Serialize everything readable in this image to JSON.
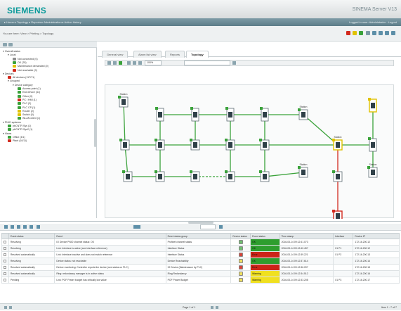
{
  "header": {
    "logo": "SIEMENS",
    "product": "SINEMA Server V13"
  },
  "nav": {
    "breadcrumbs": "▸ Home ▸ Topology ▸ Reports ▸ Administration ▸ Action history",
    "user": "Logged in user: Administrator · Logout"
  },
  "subheader": {
    "you_are_here": "You are here: View > Printing > Topology"
  },
  "tree": [
    {
      "label": "Overall status",
      "indent": 0,
      "icon": "expand",
      "color": ""
    },
    {
      "label": "Local",
      "indent": 1,
      "icon": "expand",
      "color": ""
    },
    {
      "label": "Not connected (0)",
      "indent": 2,
      "icon": "status",
      "color": "#8c8c8c"
    },
    {
      "label": "OK (78)",
      "indent": 2,
      "icon": "status",
      "color": "#3aa23a"
    },
    {
      "label": "Maintenance demanded (0)",
      "indent": 2,
      "icon": "status",
      "color": "#e0c200"
    },
    {
      "label": "Not reachable (0)",
      "indent": 2,
      "icon": "status",
      "color": "#d22a1e"
    },
    {
      "label": "Devices",
      "indent": 0,
      "icon": "expand",
      "color": ""
    },
    {
      "label": "All devices (117/71)",
      "indent": 1,
      "icon": "status",
      "color": "#d22a1e"
    },
    {
      "label": "Grouped",
      "indent": 1,
      "icon": "expand",
      "color": ""
    },
    {
      "label": "Device category",
      "indent": 2,
      "icon": "expand",
      "color": ""
    },
    {
      "label": "Access point (1)",
      "indent": 3,
      "icon": "status",
      "color": "#3aa23a"
    },
    {
      "label": "End device (41)",
      "indent": 3,
      "icon": "status",
      "color": "#3aa23a"
    },
    {
      "label": "Other (0)",
      "indent": 3,
      "icon": "status",
      "color": "#3aa23a"
    },
    {
      "label": "PC / HMI (1)",
      "indent": 3,
      "icon": "status",
      "color": "#d22a1e"
    },
    {
      "label": "PLC (2)",
      "indent": 3,
      "icon": "status",
      "color": "#3aa23a"
    },
    {
      "label": "PLC CP (1)",
      "indent": 3,
      "icon": "status",
      "color": "#3aa23a"
    },
    {
      "label": "Router (2)",
      "indent": 3,
      "icon": "status",
      "color": "#e0c200"
    },
    {
      "label": "Switch (0)",
      "indent": 3,
      "icon": "status",
      "color": "#e0c200"
    },
    {
      "label": "WLAN client (1)",
      "indent": 3,
      "icon": "status",
      "color": "#3aa23a"
    },
    {
      "label": "PNIO systems",
      "indent": 0,
      "icon": "expand",
      "color": ""
    },
    {
      "label": "pbCNTR Sys (1)",
      "indent": 1,
      "icon": "status",
      "color": "#3aa23a"
    },
    {
      "label": "pbCNTR Sys2 (1)",
      "indent": 1,
      "icon": "status",
      "color": "#3aa23a"
    },
    {
      "label": "Views",
      "indent": 0,
      "icon": "expand",
      "color": ""
    },
    {
      "label": "Office (4/1)",
      "indent": 1,
      "icon": "status",
      "color": "#3aa23a"
    },
    {
      "label": "Plant (10/11)",
      "indent": 1,
      "icon": "status",
      "color": "#d22a1e"
    }
  ],
  "tabs": [
    {
      "label": "General view"
    },
    {
      "label": "Alarm list view"
    },
    {
      "label": "Reports"
    },
    {
      "label": "Topology"
    }
  ],
  "active_tab": "Topology",
  "topo_toolbar": {
    "zoom": "100%"
  },
  "topology": {
    "nodes": [
      {
        "id": "n1",
        "label": "Station",
        "kind": "device",
        "status": "green"
      },
      {
        "id": "n2",
        "label": "",
        "kind": "device",
        "status": "green"
      },
      {
        "id": "n3",
        "label": "",
        "kind": "device",
        "status": "green"
      },
      {
        "id": "n4",
        "label": "",
        "kind": "device",
        "status": "green"
      },
      {
        "id": "n5",
        "label": "",
        "kind": "device",
        "status": "green"
      },
      {
        "id": "n6",
        "label": "",
        "kind": "device",
        "status": "green"
      },
      {
        "id": "n7",
        "label": "Station",
        "kind": "device",
        "status": "yellow"
      },
      {
        "id": "n8",
        "label": "",
        "kind": "switch",
        "status": "green"
      },
      {
        "id": "n9",
        "label": "",
        "kind": "switch",
        "status": "green"
      },
      {
        "id": "n10",
        "label": "",
        "kind": "switch",
        "status": "green"
      },
      {
        "id": "n11",
        "label": "",
        "kind": "switch",
        "status": "green"
      },
      {
        "id": "n12",
        "label": "",
        "kind": "switch",
        "status": "green"
      },
      {
        "id": "n13",
        "label": "Station",
        "kind": "device",
        "status": "green"
      },
      {
        "id": "n14",
        "label": "",
        "kind": "switch",
        "status": "yellow"
      },
      {
        "id": "n15",
        "label": "",
        "kind": "device",
        "status": "green"
      },
      {
        "id": "n16",
        "label": "",
        "kind": "device",
        "status": "green"
      },
      {
        "id": "n17",
        "label": "",
        "kind": "device",
        "status": "green"
      },
      {
        "id": "n18",
        "label": "",
        "kind": "device",
        "status": "green"
      },
      {
        "id": "n19",
        "label": "",
        "kind": "device",
        "status": "green"
      },
      {
        "id": "n20",
        "label": "Station",
        "kind": "device",
        "status": "green"
      },
      {
        "id": "n21",
        "label": "",
        "kind": "device",
        "status": "green"
      },
      {
        "id": "n22",
        "label": "",
        "kind": "device",
        "status": "red"
      },
      {
        "id": "n23",
        "label": "Station",
        "kind": "device",
        "status": "green"
      }
    ]
  },
  "alarm_table": {
    "columns": [
      "Event status",
      "Event",
      "Event status group",
      "Device status",
      "Event status",
      "Time stamp",
      "Interface",
      "Device IP"
    ],
    "rows": [
      {
        "status": "Resolving",
        "event": "IO Device PNIO channel status: OK",
        "group": "Profinet channel status",
        "dev": "green",
        "level": "OK",
        "level_color": "#2e9e2e",
        "time": "2016-03-14 09:12:41.073",
        "iface": "",
        "ip": "172.16.200.12"
      },
      {
        "status": "Resolving",
        "event": "Link: Interface is active (see interface reference)",
        "group": "Interface Status",
        "dev": "green",
        "level": "OK",
        "level_color": "#2e9e2e",
        "time": "2016-03-14 09:12:40.457",
        "iface": "X1 P1",
        "ip": "172.16.200.12"
      },
      {
        "status": "Resolved automatically",
        "event": "Link: Interface inactive and does not match reference",
        "group": "Interface Status",
        "dev": "red",
        "level": "Error",
        "level_color": "#cc2418",
        "time": "2016-03-14 09:12:39.221",
        "iface": "X1 P2",
        "ip": "172.16.200.13"
      },
      {
        "status": "Resolving",
        "event": "Device status: not reachable",
        "group": "Device Reachability",
        "dev": "yellow",
        "level": "OK",
        "level_color": "#2e9e2e",
        "time": "2016-03-14 09:12:37.614",
        "iface": "",
        "ip": "172.16.200.14"
      },
      {
        "status": "Resolved automatically",
        "event": "Device monitoring: Controller reports the device (see status on PLC)",
        "group": "IO Device (Maintenance by PLC)",
        "dev": "red",
        "level": "Error",
        "level_color": "#cc2418",
        "time": "2016-03-14 09:12:36.097",
        "iface": "",
        "ip": "172.16.200.15"
      },
      {
        "status": "Resolved automatically",
        "event": "Ring: redundancy manager is in active status",
        "group": "Ring Redundancy",
        "dev": "yellow",
        "level": "Warning",
        "level_color": "#f0e020",
        "time": "2016-03-14 09:12:34.512",
        "iface": "",
        "ip": "172.16.200.16"
      },
      {
        "status": "Pending",
        "event": "Link: POF Power budget has critically low value",
        "group": "POF Power Budget",
        "dev": "yellow",
        "level": "Warning",
        "level_color": "#f0e020",
        "time": "2016-03-14 09:12:33.208",
        "iface": "X1 P3",
        "ip": "172.16.200.17"
      }
    ]
  },
  "footer": {
    "pager": "Page 1 of 1",
    "count": "Item 1 - 7 of 7"
  }
}
